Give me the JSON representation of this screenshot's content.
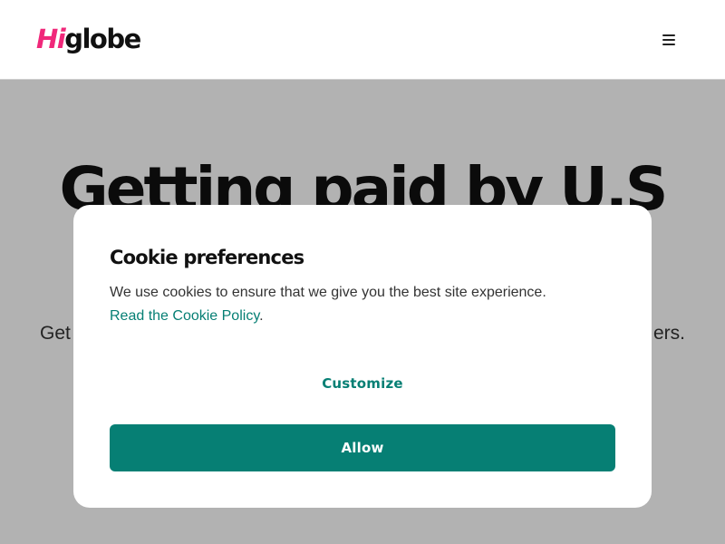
{
  "header": {
    "logo": {
      "part1": "Hi",
      "part2": "globe"
    },
    "menu_icon": "hamburger-menu-icon"
  },
  "hero": {
    "title": "Getting paid by U.S",
    "subtitle_start": "Get",
    "subtitle_end": "ers."
  },
  "cookie_modal": {
    "title": "Cookie preferences",
    "text": "We use cookies to ensure that we give you the best site experience.",
    "link_text": "Read the Cookie Policy",
    "link_suffix": ".",
    "customize_label": "Customize",
    "allow_label": "Allow"
  },
  "colors": {
    "brand_pink": "#f0287a",
    "accent_teal": "#067f74",
    "overlay": "rgba(0,0,0,0.3)"
  }
}
